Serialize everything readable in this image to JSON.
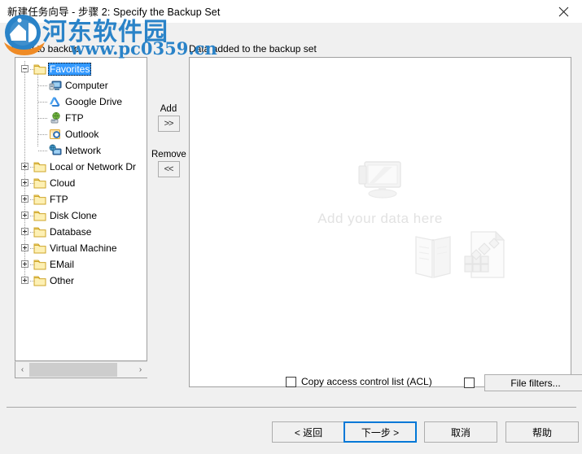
{
  "window": {
    "title": "新建任务向导 - 步骤 2: Specify the Backup Set",
    "close_label": "✕"
  },
  "labels": {
    "left_panel": "What to backup",
    "right_panel": "Data added to the backup set"
  },
  "tree": {
    "nodes": [
      {
        "label": "Favorites",
        "icon": "folder-icon",
        "indent": 0,
        "expander": "minus",
        "selected": true
      },
      {
        "label": "Computer",
        "icon": "computer-icon",
        "indent": 1,
        "expander": "none",
        "selected": false
      },
      {
        "label": "Google Drive",
        "icon": "google-drive-icon",
        "indent": 1,
        "expander": "none",
        "selected": false
      },
      {
        "label": "FTP",
        "icon": "ftp-icon",
        "indent": 1,
        "expander": "none",
        "selected": false
      },
      {
        "label": "Outlook",
        "icon": "outlook-icon",
        "indent": 1,
        "expander": "none",
        "selected": false
      },
      {
        "label": "Network",
        "icon": "network-icon",
        "indent": 1,
        "expander": "none",
        "selected": false
      },
      {
        "label": "Local or Network Dr",
        "icon": "folder-icon",
        "indent": 0,
        "expander": "plus",
        "selected": false
      },
      {
        "label": "Cloud",
        "icon": "folder-icon",
        "indent": 0,
        "expander": "plus",
        "selected": false
      },
      {
        "label": "FTP",
        "icon": "folder-icon",
        "indent": 0,
        "expander": "plus",
        "selected": false
      },
      {
        "label": "Disk Clone",
        "icon": "folder-icon",
        "indent": 0,
        "expander": "plus",
        "selected": false
      },
      {
        "label": "Database",
        "icon": "folder-icon",
        "indent": 0,
        "expander": "plus",
        "selected": false
      },
      {
        "label": "Virtual Machine",
        "icon": "folder-icon",
        "indent": 0,
        "expander": "plus",
        "selected": false
      },
      {
        "label": "EMail",
        "icon": "folder-icon",
        "indent": 0,
        "expander": "plus",
        "selected": false
      },
      {
        "label": "Other",
        "icon": "folder-icon",
        "indent": 0,
        "expander": "plus",
        "selected": false
      }
    ],
    "scroll_left_arrow": "‹",
    "scroll_right_arrow": "›"
  },
  "transfer": {
    "add_caption": "Add",
    "add_glyph": ">>",
    "remove_caption": "Remove",
    "remove_glyph": "<<"
  },
  "list": {
    "placeholder_text": "Add your data here"
  },
  "options": {
    "acl_label": "Copy access control list (ACL)",
    "acl_checked": false,
    "filters_checked": false,
    "filters_button": "File filters..."
  },
  "footer": {
    "back": "< 返回",
    "next": "下一步 >",
    "cancel": "取消",
    "help": "帮助"
  },
  "watermark": {
    "brand": "河东软件园",
    "url": "www.pc0359.cn"
  },
  "colors": {
    "accent": "#0078d7",
    "selection": "#3399ff",
    "watermark": "#2a83c8",
    "placeholder": "#e2e2e2"
  }
}
